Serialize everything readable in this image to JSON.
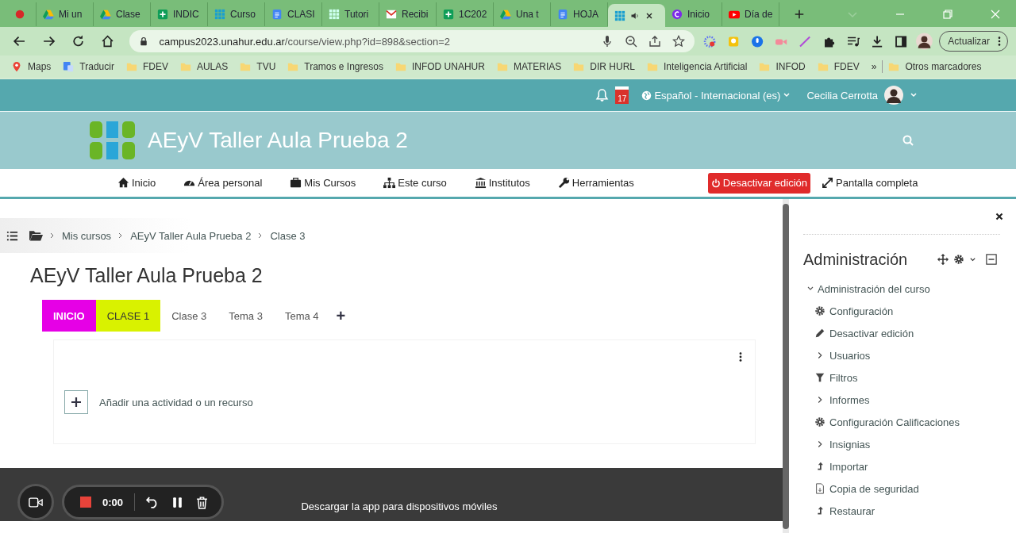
{
  "browser": {
    "tabs": [
      {
        "kind": "record",
        "selected": false,
        "audio": false
      },
      {
        "kind": "drive",
        "title": "Mi un",
        "selected": false,
        "audio": false
      },
      {
        "kind": "drive",
        "title": "Clase",
        "selected": false,
        "audio": false
      },
      {
        "kind": "sheets",
        "title": "INDIC",
        "selected": false,
        "audio": false
      },
      {
        "kind": "grid",
        "title": "Curso",
        "selected": false,
        "audio": false
      },
      {
        "kind": "docs",
        "title": "CLASI",
        "selected": false,
        "audio": false
      },
      {
        "kind": "grid-light",
        "title": "Tutori",
        "selected": false,
        "audio": false
      },
      {
        "kind": "mail",
        "title": "Recibi",
        "selected": false,
        "audio": false
      },
      {
        "kind": "sheets",
        "title": "1C202",
        "selected": false,
        "audio": false
      },
      {
        "kind": "drive",
        "title": "Una t",
        "selected": false,
        "audio": false
      },
      {
        "kind": "docs",
        "title": "HOJA",
        "selected": false,
        "audio": false
      },
      {
        "kind": "grid",
        "selected": true,
        "audio": true
      },
      {
        "kind": "canva",
        "title": "Inicio",
        "selected": false,
        "audio": false
      },
      {
        "kind": "youtube",
        "title": "Día de",
        "selected": false,
        "audio": false
      }
    ],
    "address": {
      "host": "campus2023.unahur.edu.ar",
      "path": "/course/view.php?id=898&section=2"
    },
    "update_button": "Actualizar",
    "bookmarks": [
      {
        "kind": "maps",
        "label": "Maps"
      },
      {
        "kind": "translate",
        "label": "Traducir"
      },
      {
        "kind": "folder",
        "label": "FDEV"
      },
      {
        "kind": "folder",
        "label": "AULAS"
      },
      {
        "kind": "folder",
        "label": "TVU"
      },
      {
        "kind": "folder",
        "label": "Tramos e Ingresos"
      },
      {
        "kind": "folder",
        "label": "INFOD UNAHUR"
      },
      {
        "kind": "folder",
        "label": "MATERIAS"
      },
      {
        "kind": "folder",
        "label": "DIR HURL"
      },
      {
        "kind": "folder",
        "label": "Inteligencia Artificial"
      },
      {
        "kind": "folder",
        "label": "INFOD"
      },
      {
        "kind": "folder",
        "label": "FDEV"
      }
    ],
    "bookmarks_overflow": "»",
    "other_bookmarks": "Otros marcadores"
  },
  "topbar": {
    "calendar_badge": "17",
    "language": "Español - Internacional (es)",
    "user": "Cecilia Cerrotta"
  },
  "header": {
    "site_title": "AEyV Taller Aula Prueba 2"
  },
  "nav": {
    "items": [
      {
        "kind": "home",
        "label": "Inicio"
      },
      {
        "kind": "dashboard",
        "label": "Área personal"
      },
      {
        "kind": "briefcase",
        "label": "Mis Cursos"
      },
      {
        "kind": "sitemap",
        "label": "Este curso"
      },
      {
        "kind": "bank",
        "label": "Institutos"
      },
      {
        "kind": "wrench",
        "label": "Herramientas"
      }
    ],
    "edit_button": "Desactivar edición",
    "fullscreen": "Pantalla completa"
  },
  "breadcrumb": [
    "Mis cursos",
    "AEyV Taller Aula Prueba 2",
    "Clase 3"
  ],
  "course_title": "AEyV Taller Aula Prueba 2",
  "section_tabs": [
    {
      "label": "INICIO",
      "color": "#e600e6"
    },
    {
      "label": "CLASE 1",
      "color": "#d9f200"
    },
    {
      "label": "Clase 3"
    },
    {
      "label": "Tema 3"
    },
    {
      "label": "Tema 4"
    }
  ],
  "add_section": "+",
  "add_activity": "Añadir una actividad o un recurso",
  "footer": {
    "text": "Descargar la app para dispositivos móviles"
  },
  "recorder": {
    "time": "0:00"
  },
  "admin": {
    "title": "Administración",
    "items": [
      {
        "label": "Administración del curso",
        "expanded": true,
        "children": [
          {
            "kind": "gear",
            "label": "Configuración"
          },
          {
            "kind": "pencil",
            "label": "Desactivar edición"
          },
          {
            "kind": "branch",
            "label": "Usuarios",
            "expanded": false
          },
          {
            "kind": "filter",
            "label": "Filtros"
          },
          {
            "kind": "branch",
            "label": "Informes",
            "expanded": false
          },
          {
            "kind": "gear",
            "label": "Configuración Calificaciones"
          },
          {
            "kind": "branch",
            "label": "Insignias",
            "expanded": false
          },
          {
            "kind": "upload",
            "label": "Importar"
          },
          {
            "kind": "backup",
            "label": "Copia de seguridad"
          },
          {
            "kind": "upload",
            "label": "Restaurar"
          }
        ]
      }
    ]
  }
}
